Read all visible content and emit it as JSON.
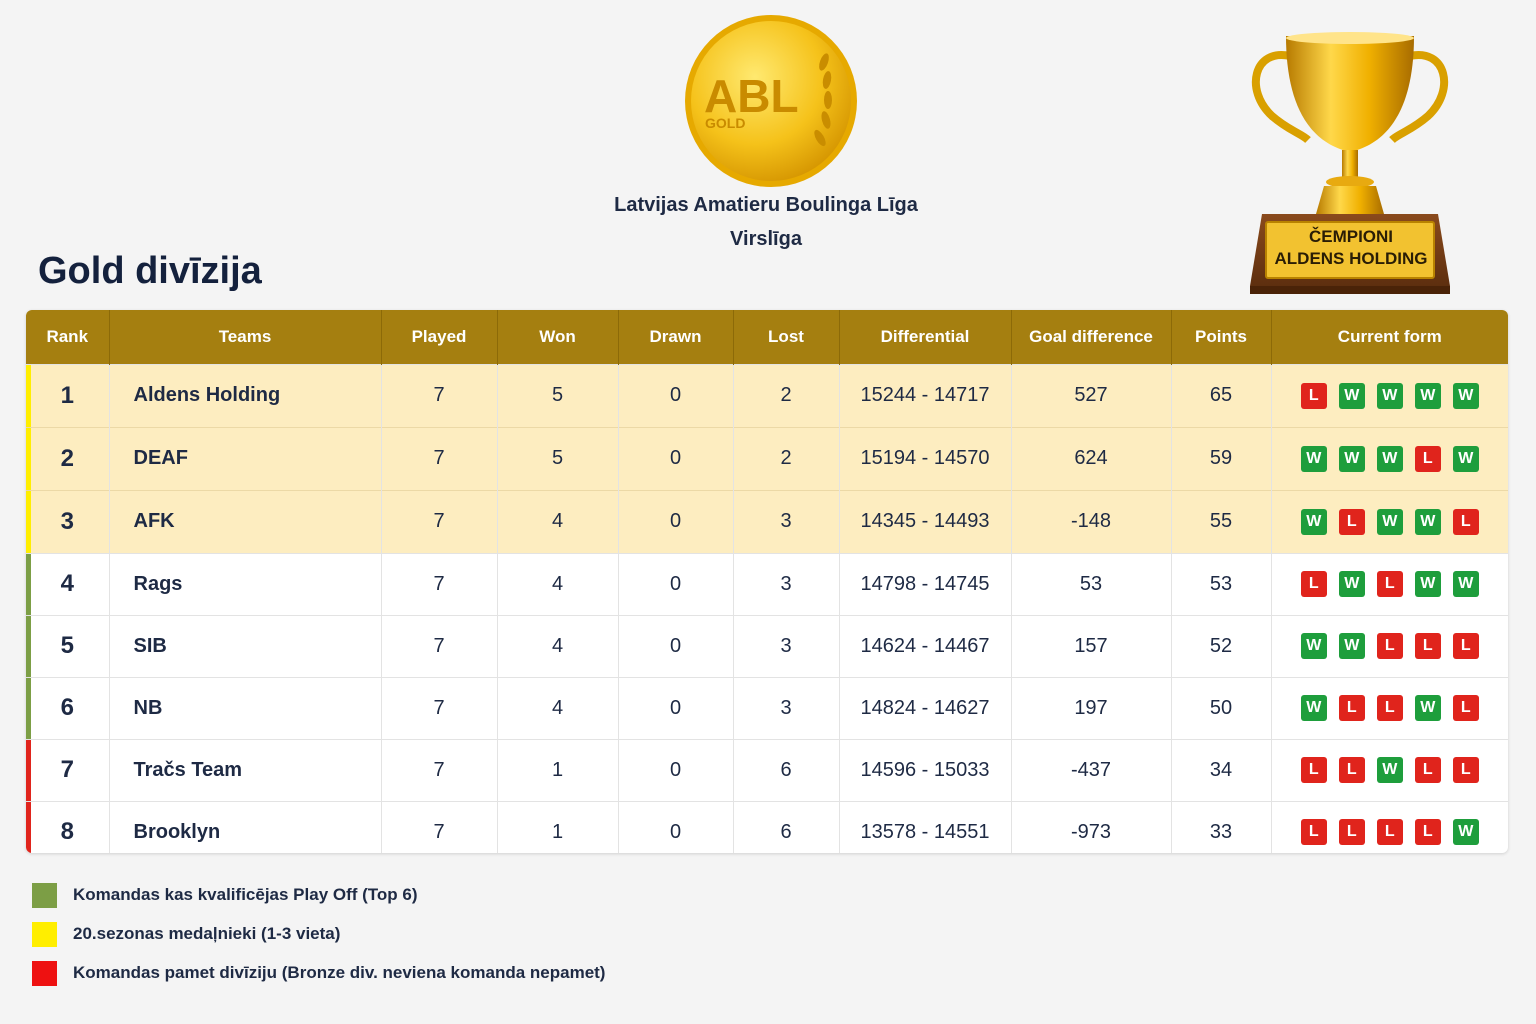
{
  "header": {
    "logo_text": "ABL",
    "logo_sub": "GOLD",
    "league_name": "Latvijas Amatieru Boulinga Līga",
    "league_sub": "Virslīga",
    "division_title": "Gold divīzija",
    "champion_label": "ČEMPIONI",
    "champion_team": "ALDENS HOLDING"
  },
  "table": {
    "columns": [
      "Rank",
      "Teams",
      "Played",
      "Won",
      "Drawn",
      "Lost",
      "Differential",
      "Goal difference",
      "Points",
      "Current form"
    ],
    "rows": [
      {
        "rank": "1",
        "team": "Aldens Holding",
        "played": "7",
        "won": "5",
        "drawn": "0",
        "lost": "2",
        "differential": "15244 - 14717",
        "goal_diff": "527",
        "points": "65",
        "form": [
          "L",
          "W",
          "W",
          "W",
          "W"
        ],
        "status": "medal"
      },
      {
        "rank": "2",
        "team": "DEAF",
        "played": "7",
        "won": "5",
        "drawn": "0",
        "lost": "2",
        "differential": "15194 - 14570",
        "goal_diff": "624",
        "points": "59",
        "form": [
          "W",
          "W",
          "W",
          "L",
          "W"
        ],
        "status": "medal"
      },
      {
        "rank": "3",
        "team": "AFK",
        "played": "7",
        "won": "4",
        "drawn": "0",
        "lost": "3",
        "differential": "14345 - 14493",
        "goal_diff": "-148",
        "points": "55",
        "form": [
          "W",
          "L",
          "W",
          "W",
          "L"
        ],
        "status": "medal"
      },
      {
        "rank": "4",
        "team": "Rags",
        "played": "7",
        "won": "4",
        "drawn": "0",
        "lost": "3",
        "differential": "14798 - 14745",
        "goal_diff": "53",
        "points": "53",
        "form": [
          "L",
          "W",
          "L",
          "W",
          "W"
        ],
        "status": "playoff"
      },
      {
        "rank": "5",
        "team": "SIB",
        "played": "7",
        "won": "4",
        "drawn": "0",
        "lost": "3",
        "differential": "14624 - 14467",
        "goal_diff": "157",
        "points": "52",
        "form": [
          "W",
          "W",
          "L",
          "L",
          "L"
        ],
        "status": "playoff"
      },
      {
        "rank": "6",
        "team": "NB",
        "played": "7",
        "won": "4",
        "drawn": "0",
        "lost": "3",
        "differential": "14824 - 14627",
        "goal_diff": "197",
        "points": "50",
        "form": [
          "W",
          "L",
          "L",
          "W",
          "L"
        ],
        "status": "playoff"
      },
      {
        "rank": "7",
        "team": "Tračs Team",
        "played": "7",
        "won": "1",
        "drawn": "0",
        "lost": "6",
        "differential": "14596 - 15033",
        "goal_diff": "-437",
        "points": "34",
        "form": [
          "L",
          "L",
          "W",
          "L",
          "L"
        ],
        "status": "relegation"
      },
      {
        "rank": "8",
        "team": "Brooklyn",
        "played": "7",
        "won": "1",
        "drawn": "0",
        "lost": "6",
        "differential": "13578 - 14551",
        "goal_diff": "-973",
        "points": "33",
        "form": [
          "L",
          "L",
          "L",
          "L",
          "W"
        ],
        "status": "relegation"
      }
    ]
  },
  "status_colors": {
    "medal": "#ffee00",
    "playoff": "#7c9e45",
    "relegation": "#e0241c"
  },
  "legend": [
    {
      "color": "#7c9e45",
      "label": "Komandas kas kvalificējas Play Off (Top 6)"
    },
    {
      "color": "#ffee00",
      "label": "20.sezonas medaļnieki (1-3 vieta)"
    },
    {
      "color": "#ee1111",
      "label": "Komandas pamet divīziju (Bronze div. neviena komanda nepamet)"
    }
  ]
}
